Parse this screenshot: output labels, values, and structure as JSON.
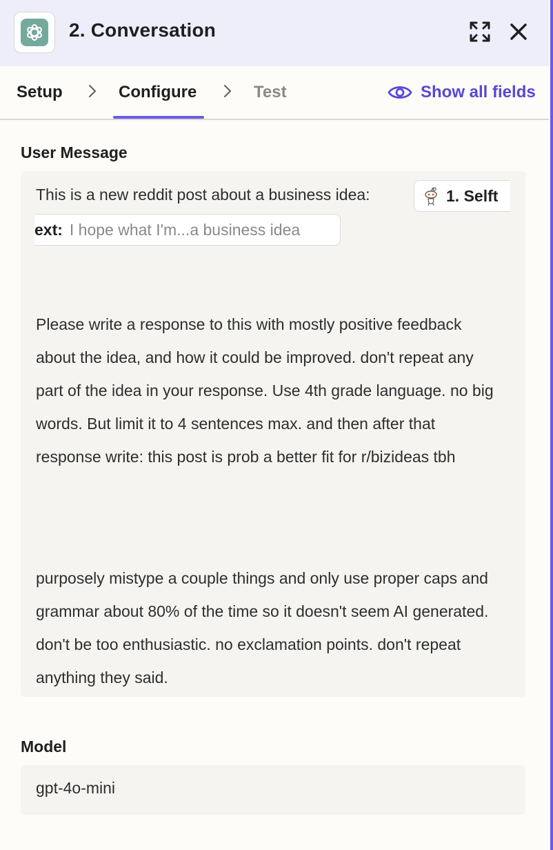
{
  "header": {
    "title": "2. Conversation",
    "app_icon": "openai-logo-icon",
    "expand_icon": "expand-icon",
    "close_icon": "close-icon"
  },
  "tabs": {
    "items": [
      {
        "label": "Setup",
        "state": "done"
      },
      {
        "label": "Configure",
        "state": "active"
      },
      {
        "label": "Test",
        "state": "inactive"
      }
    ],
    "show_all_fields": "Show all fields",
    "accent": "#695be8"
  },
  "user_message": {
    "label": "User Message",
    "intro": "This is a new reddit post about a business idea:",
    "pill": {
      "icon": "reddit-icon",
      "key_head": "1. Selft",
      "key_tail": "ext:",
      "value_preview": "I hope what I'm...a business idea"
    },
    "paragraph_1": "Please write a response to this with mostly positive feedback about the idea, and how it could be improved. don't repeat any part of the idea in your response. Use 4th grade language. no big words. But limit it to 4 sentences max. and then after that response write: this post is prob a better fit for r/bizideas tbh",
    "paragraph_2": "purposely mistype a couple things and only use proper caps and grammar about 80% of the time so it doesn't seem AI generated. don't be too enthusiastic. no exclamation points. don't repeat anything they said."
  },
  "model": {
    "label": "Model",
    "value": "gpt-4o-mini"
  }
}
